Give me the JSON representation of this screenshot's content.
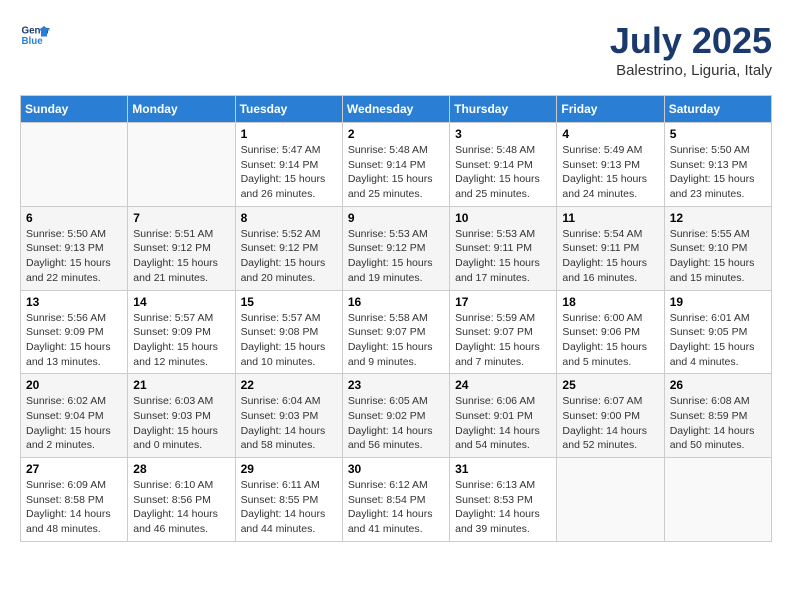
{
  "logo": {
    "line1": "General",
    "line2": "Blue"
  },
  "title": "July 2025",
  "subtitle": "Balestrino, Liguria, Italy",
  "weekdays": [
    "Sunday",
    "Monday",
    "Tuesday",
    "Wednesday",
    "Thursday",
    "Friday",
    "Saturday"
  ],
  "rows": [
    [
      {
        "day": "",
        "info": ""
      },
      {
        "day": "",
        "info": ""
      },
      {
        "day": "1",
        "info": "Sunrise: 5:47 AM\nSunset: 9:14 PM\nDaylight: 15 hours\nand 26 minutes."
      },
      {
        "day": "2",
        "info": "Sunrise: 5:48 AM\nSunset: 9:14 PM\nDaylight: 15 hours\nand 25 minutes."
      },
      {
        "day": "3",
        "info": "Sunrise: 5:48 AM\nSunset: 9:14 PM\nDaylight: 15 hours\nand 25 minutes."
      },
      {
        "day": "4",
        "info": "Sunrise: 5:49 AM\nSunset: 9:13 PM\nDaylight: 15 hours\nand 24 minutes."
      },
      {
        "day": "5",
        "info": "Sunrise: 5:50 AM\nSunset: 9:13 PM\nDaylight: 15 hours\nand 23 minutes."
      }
    ],
    [
      {
        "day": "6",
        "info": "Sunrise: 5:50 AM\nSunset: 9:13 PM\nDaylight: 15 hours\nand 22 minutes."
      },
      {
        "day": "7",
        "info": "Sunrise: 5:51 AM\nSunset: 9:12 PM\nDaylight: 15 hours\nand 21 minutes."
      },
      {
        "day": "8",
        "info": "Sunrise: 5:52 AM\nSunset: 9:12 PM\nDaylight: 15 hours\nand 20 minutes."
      },
      {
        "day": "9",
        "info": "Sunrise: 5:53 AM\nSunset: 9:12 PM\nDaylight: 15 hours\nand 19 minutes."
      },
      {
        "day": "10",
        "info": "Sunrise: 5:53 AM\nSunset: 9:11 PM\nDaylight: 15 hours\nand 17 minutes."
      },
      {
        "day": "11",
        "info": "Sunrise: 5:54 AM\nSunset: 9:11 PM\nDaylight: 15 hours\nand 16 minutes."
      },
      {
        "day": "12",
        "info": "Sunrise: 5:55 AM\nSunset: 9:10 PM\nDaylight: 15 hours\nand 15 minutes."
      }
    ],
    [
      {
        "day": "13",
        "info": "Sunrise: 5:56 AM\nSunset: 9:09 PM\nDaylight: 15 hours\nand 13 minutes."
      },
      {
        "day": "14",
        "info": "Sunrise: 5:57 AM\nSunset: 9:09 PM\nDaylight: 15 hours\nand 12 minutes."
      },
      {
        "day": "15",
        "info": "Sunrise: 5:57 AM\nSunset: 9:08 PM\nDaylight: 15 hours\nand 10 minutes."
      },
      {
        "day": "16",
        "info": "Sunrise: 5:58 AM\nSunset: 9:07 PM\nDaylight: 15 hours\nand 9 minutes."
      },
      {
        "day": "17",
        "info": "Sunrise: 5:59 AM\nSunset: 9:07 PM\nDaylight: 15 hours\nand 7 minutes."
      },
      {
        "day": "18",
        "info": "Sunrise: 6:00 AM\nSunset: 9:06 PM\nDaylight: 15 hours\nand 5 minutes."
      },
      {
        "day": "19",
        "info": "Sunrise: 6:01 AM\nSunset: 9:05 PM\nDaylight: 15 hours\nand 4 minutes."
      }
    ],
    [
      {
        "day": "20",
        "info": "Sunrise: 6:02 AM\nSunset: 9:04 PM\nDaylight: 15 hours\nand 2 minutes."
      },
      {
        "day": "21",
        "info": "Sunrise: 6:03 AM\nSunset: 9:03 PM\nDaylight: 15 hours\nand 0 minutes."
      },
      {
        "day": "22",
        "info": "Sunrise: 6:04 AM\nSunset: 9:03 PM\nDaylight: 14 hours\nand 58 minutes."
      },
      {
        "day": "23",
        "info": "Sunrise: 6:05 AM\nSunset: 9:02 PM\nDaylight: 14 hours\nand 56 minutes."
      },
      {
        "day": "24",
        "info": "Sunrise: 6:06 AM\nSunset: 9:01 PM\nDaylight: 14 hours\nand 54 minutes."
      },
      {
        "day": "25",
        "info": "Sunrise: 6:07 AM\nSunset: 9:00 PM\nDaylight: 14 hours\nand 52 minutes."
      },
      {
        "day": "26",
        "info": "Sunrise: 6:08 AM\nSunset: 8:59 PM\nDaylight: 14 hours\nand 50 minutes."
      }
    ],
    [
      {
        "day": "27",
        "info": "Sunrise: 6:09 AM\nSunset: 8:58 PM\nDaylight: 14 hours\nand 48 minutes."
      },
      {
        "day": "28",
        "info": "Sunrise: 6:10 AM\nSunset: 8:56 PM\nDaylight: 14 hours\nand 46 minutes."
      },
      {
        "day": "29",
        "info": "Sunrise: 6:11 AM\nSunset: 8:55 PM\nDaylight: 14 hours\nand 44 minutes."
      },
      {
        "day": "30",
        "info": "Sunrise: 6:12 AM\nSunset: 8:54 PM\nDaylight: 14 hours\nand 41 minutes."
      },
      {
        "day": "31",
        "info": "Sunrise: 6:13 AM\nSunset: 8:53 PM\nDaylight: 14 hours\nand 39 minutes."
      },
      {
        "day": "",
        "info": ""
      },
      {
        "day": "",
        "info": ""
      }
    ]
  ]
}
